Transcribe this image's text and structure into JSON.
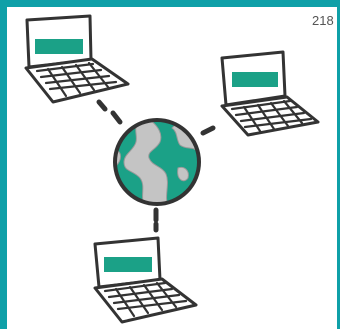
{
  "page": {
    "number": "218"
  },
  "diagram": {
    "nodes": [
      {
        "name": "laptop-top-left",
        "icon": "laptop-icon"
      },
      {
        "name": "laptop-top-right",
        "icon": "laptop-icon"
      },
      {
        "name": "laptop-bottom",
        "icon": "laptop-icon"
      },
      {
        "name": "globe",
        "icon": "globe-icon"
      }
    ],
    "colors": {
      "frame": "#0fa0a8",
      "accent": "#1ba187",
      "ink": "#333333",
      "globe_land": "#bfbfbf"
    }
  }
}
